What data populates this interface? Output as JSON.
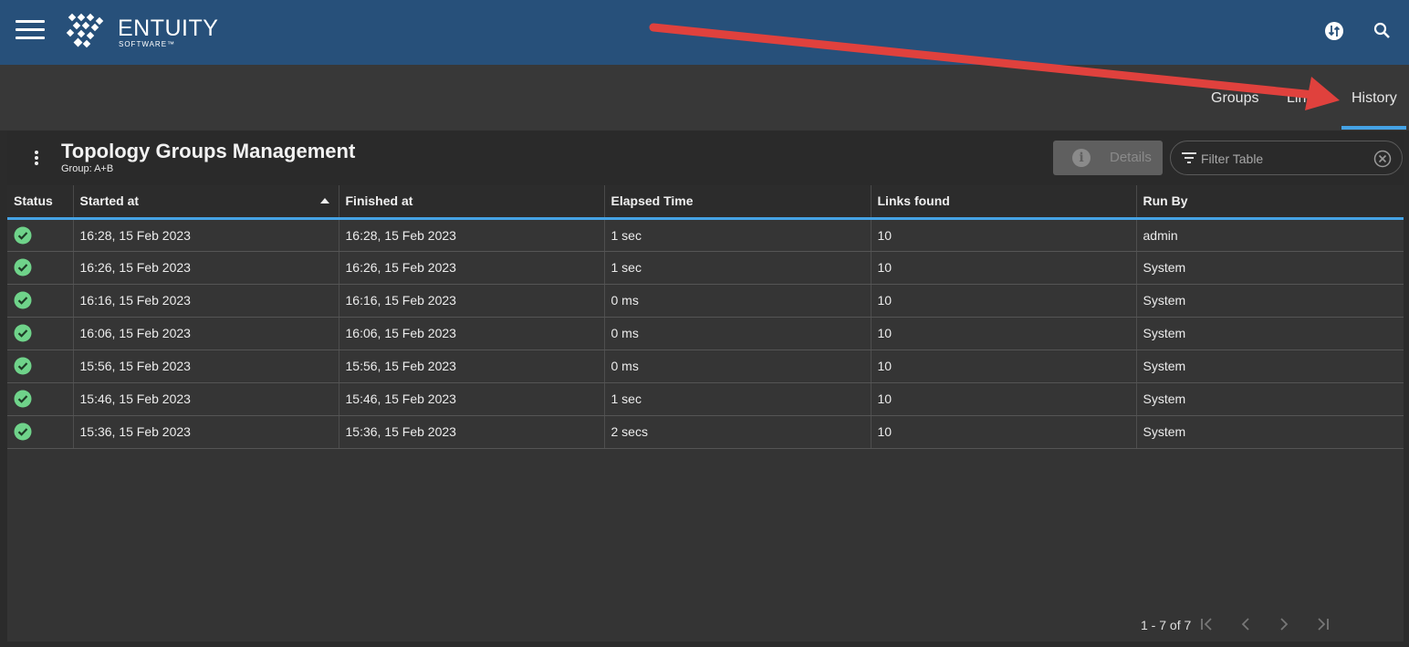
{
  "brand": {
    "name": "ENTUITY",
    "sub": "SOFTWARE™"
  },
  "header": {
    "icons": [
      "menu-icon",
      "swap-icon",
      "search-icon"
    ]
  },
  "tabs": [
    {
      "label": "Groups"
    },
    {
      "label": "Links"
    },
    {
      "label": "History"
    }
  ],
  "active_tab": "History",
  "panel": {
    "title": "Topology Groups Management",
    "subtitle": "Group: A+B",
    "details_label": "Details",
    "filter_placeholder": "Filter Table"
  },
  "table": {
    "columns": [
      "Status",
      "Started at",
      "Finished at",
      "Elapsed Time",
      "Links found",
      "Run By"
    ],
    "sorted_column": "Started at",
    "rows": [
      {
        "status": "success",
        "started": "16:28, 15 Feb 2023",
        "finished": "16:28, 15 Feb 2023",
        "elapsed": "1 sec",
        "links": "10",
        "run_by": "admin"
      },
      {
        "status": "success",
        "started": "16:26, 15 Feb 2023",
        "finished": "16:26, 15 Feb 2023",
        "elapsed": "1 sec",
        "links": "10",
        "run_by": "System"
      },
      {
        "status": "success",
        "started": "16:16, 15 Feb 2023",
        "finished": "16:16, 15 Feb 2023",
        "elapsed": "0 ms",
        "links": "10",
        "run_by": "System"
      },
      {
        "status": "success",
        "started": "16:06, 15 Feb 2023",
        "finished": "16:06, 15 Feb 2023",
        "elapsed": "0 ms",
        "links": "10",
        "run_by": "System"
      },
      {
        "status": "success",
        "started": "15:56, 15 Feb 2023",
        "finished": "15:56, 15 Feb 2023",
        "elapsed": "0 ms",
        "links": "10",
        "run_by": "System"
      },
      {
        "status": "success",
        "started": "15:46, 15 Feb 2023",
        "finished": "15:46, 15 Feb 2023",
        "elapsed": "1 sec",
        "links": "10",
        "run_by": "System"
      },
      {
        "status": "success",
        "started": "15:36, 15 Feb 2023",
        "finished": "15:36, 15 Feb 2023",
        "elapsed": "2 secs",
        "links": "10",
        "run_by": "System"
      }
    ]
  },
  "pagination": {
    "range": "1 - 7 of 7"
  },
  "colors": {
    "header_bg": "#27507a",
    "accent": "#45a3e5",
    "success": "#6fd38a",
    "annotation_arrow": "#e0413d"
  }
}
